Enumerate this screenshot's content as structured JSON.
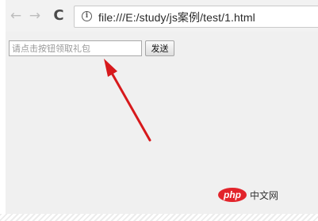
{
  "browser": {
    "url": "file:///E:/study/js案例/test/1.html",
    "back_glyph": "←",
    "forward_glyph": "→",
    "reload_glyph": "C",
    "info_glyph": "i"
  },
  "form": {
    "input_placeholder": "请点击按钮领取礼包",
    "input_value": "",
    "send_label": "发送"
  },
  "watermark": {
    "logo_text": "php",
    "site_text": "中文网"
  },
  "colors": {
    "arrow": "#d7191c",
    "logo": "#e2242b"
  }
}
